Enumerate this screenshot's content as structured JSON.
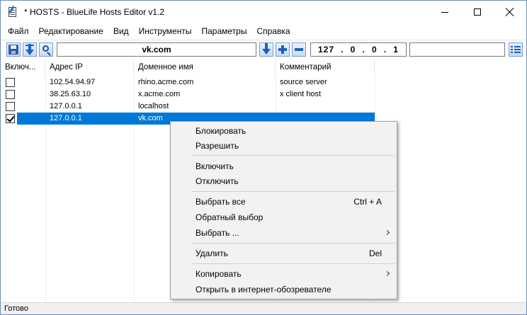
{
  "window": {
    "title": "* HOSTS - BlueLife Hosts Editor v1.2",
    "icon": "notepad-pencil-icon"
  },
  "menu": [
    "Файл",
    "Редактирование",
    "Вид",
    "Инструменты",
    "Параметры",
    "Справка"
  ],
  "toolbar": {
    "domain_value": "vk.com",
    "ip_octets": [
      "127",
      "0",
      "0",
      "1"
    ],
    "comment_value": "",
    "icons": [
      "save-icon",
      "download-arrow-icon",
      "search-icon",
      "arrow-down-icon",
      "add-icon",
      "remove-icon",
      "list-icon"
    ]
  },
  "table": {
    "headers": [
      "Включ...",
      "Адрес IP",
      "Доменное имя",
      "Комментарий"
    ],
    "rows": [
      {
        "enabled": false,
        "ip": "102.54.94.97",
        "domain": "rhino.acme.com",
        "comment": "source server",
        "selected": false
      },
      {
        "enabled": false,
        "ip": "38.25.63.10",
        "domain": "x.acme.com",
        "comment": "x client host",
        "selected": false
      },
      {
        "enabled": false,
        "ip": "127.0.0.1",
        "domain": "localhost",
        "comment": "",
        "selected": false
      },
      {
        "enabled": true,
        "ip": "127.0.0.1",
        "domain": "vk.com",
        "comment": "",
        "selected": true
      }
    ]
  },
  "context_menu": {
    "block": "Блокировать",
    "allow": "Разрешить",
    "enable": "Включить",
    "disable": "Отключить",
    "select_all": "Выбрать все",
    "select_all_shortcut": "Ctrl + A",
    "invert_selection": "Обратный выбор",
    "select_submenu": "Выбрать ...",
    "delete": "Удалить",
    "delete_shortcut": "Del",
    "copy": "Копировать",
    "open_in_browser": "Открыть в интернет-обозревателе"
  },
  "status": "Готово",
  "colors": {
    "selection": "#0078d7",
    "accent": "#1f5fbf"
  }
}
